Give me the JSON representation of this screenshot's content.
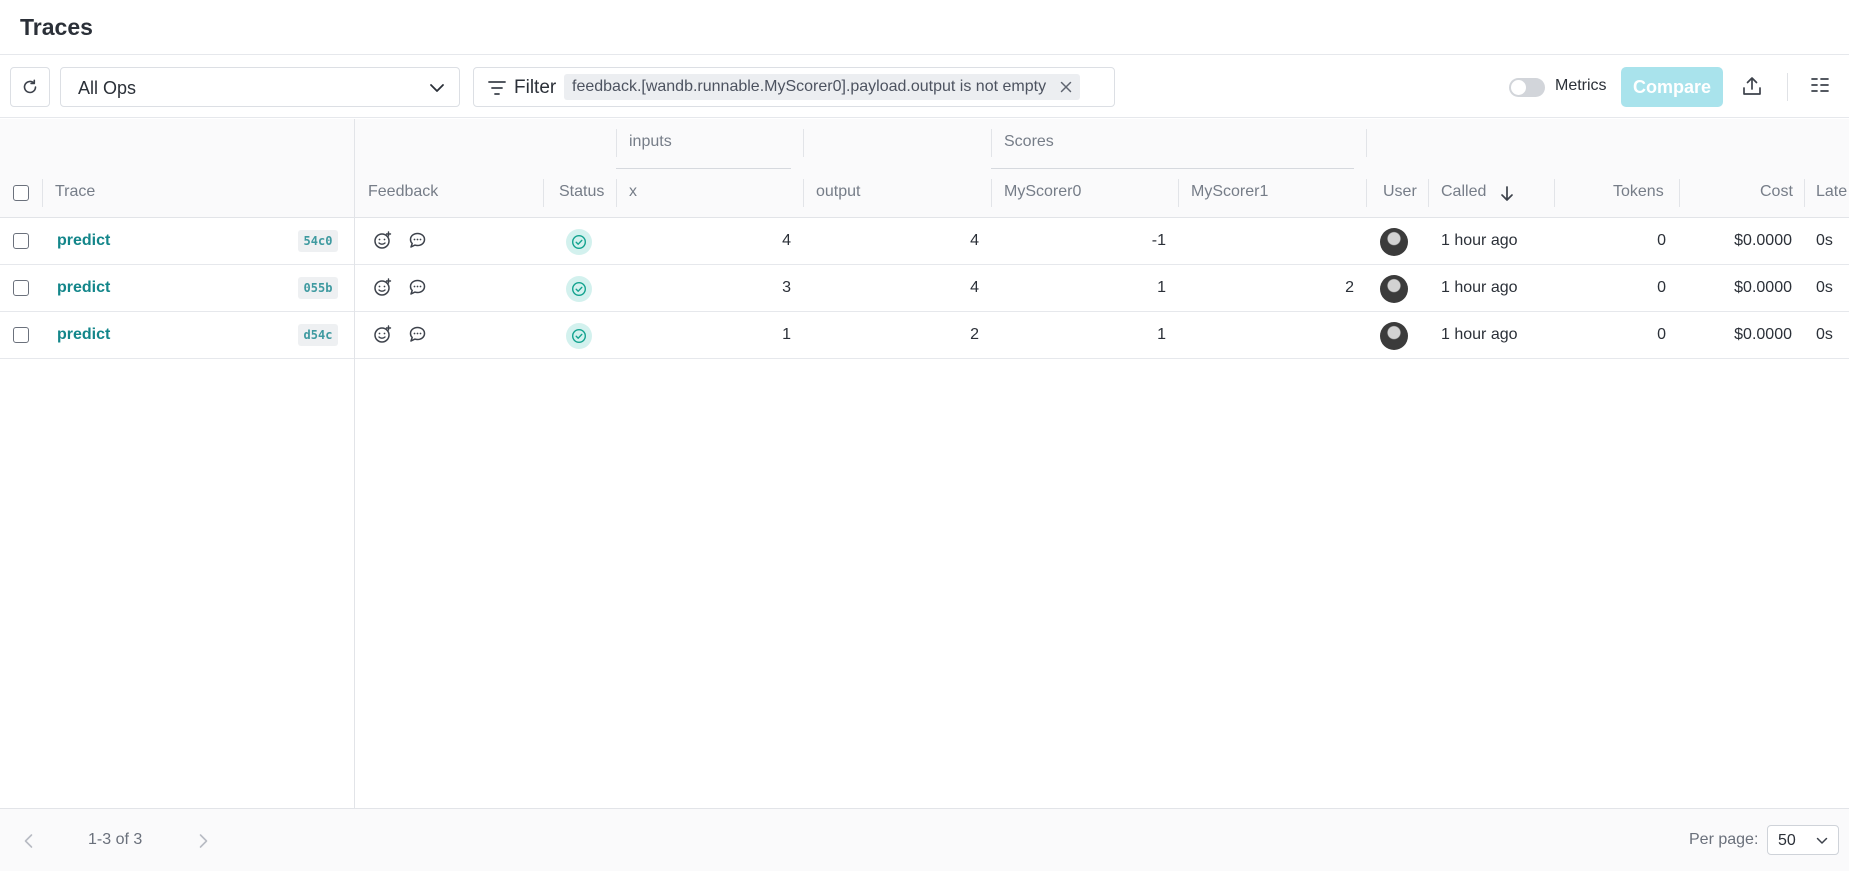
{
  "page": {
    "title": "Traces"
  },
  "toolbar": {
    "ops_select": {
      "value": "All Ops"
    },
    "filter": {
      "label": "Filter",
      "chip": "feedback.[wandb.runnable.MyScorer0].payload.output is not empty"
    },
    "metrics_toggle": {
      "label": "Metrics",
      "enabled": false
    },
    "compare_button": "Compare",
    "icons": [
      "refresh-icon",
      "chevron-down-icon",
      "filter-icon",
      "close-icon",
      "export-icon",
      "columns-icon"
    ]
  },
  "table": {
    "group_headers": {
      "inputs": "inputs",
      "scores": "Scores"
    },
    "columns": {
      "trace": "Trace",
      "feedback": "Feedback",
      "status": "Status",
      "x": "x",
      "output": "output",
      "myscorer0": "MyScorer0",
      "myscorer1": "MyScorer1",
      "user": "User",
      "called": "Called",
      "tokens": "Tokens",
      "cost": "Cost",
      "latency": "Late"
    },
    "sort": {
      "column": "Called",
      "direction": "desc"
    },
    "rows": [
      {
        "op": "predict",
        "hash": "54c0",
        "status": "success",
        "x": "4",
        "output": "4",
        "myscorer0": "-1",
        "myscorer1": "",
        "called": "1 hour ago",
        "tokens": "0",
        "cost": "$0.0000",
        "latency": "0s"
      },
      {
        "op": "predict",
        "hash": "055b",
        "status": "success",
        "x": "3",
        "output": "4",
        "myscorer0": "1",
        "myscorer1": "2",
        "called": "1 hour ago",
        "tokens": "0",
        "cost": "$0.0000",
        "latency": "0s"
      },
      {
        "op": "predict",
        "hash": "d54c",
        "status": "success",
        "x": "1",
        "output": "2",
        "myscorer0": "1",
        "myscorer1": "",
        "called": "1 hour ago",
        "tokens": "0",
        "cost": "$0.0000",
        "latency": "0s"
      }
    ]
  },
  "pagination": {
    "info": "1-3 of 3",
    "per_page_label": "Per page:",
    "per_page_value": "50"
  },
  "colors": {
    "accent": "#13868a",
    "compare_bg": "#a9e3ec",
    "status_bg": "#d3f1ee",
    "status_fg": "#13a38f"
  }
}
